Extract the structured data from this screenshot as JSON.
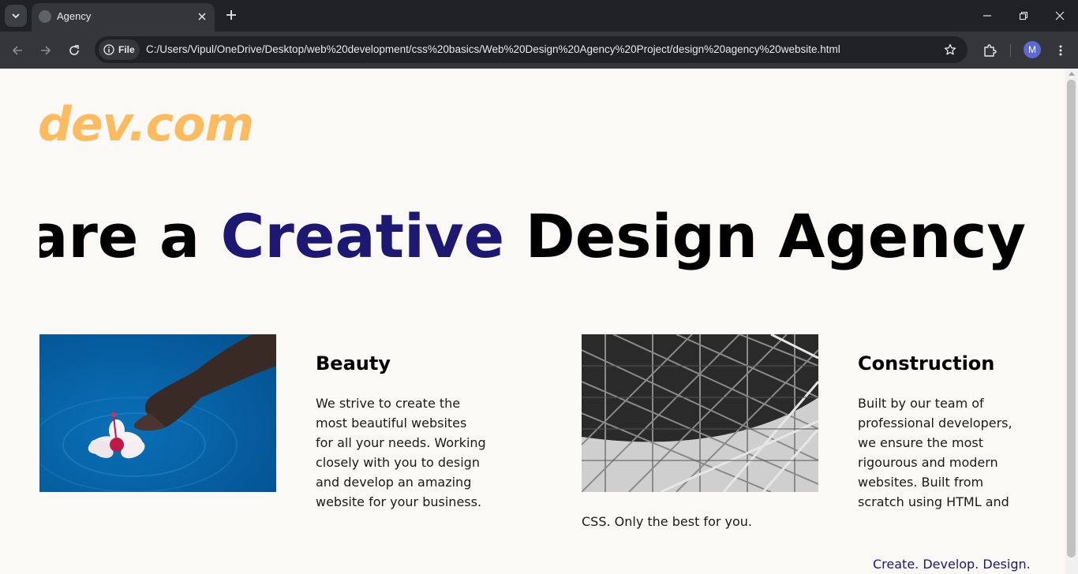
{
  "browser": {
    "tab": {
      "title": "Agency"
    },
    "address_bar": {
      "scheme_label": "File",
      "url": "C:/Users/Vipul/OneDrive/Desktop/web%20development/css%20basics/Web%20Design%20Agency%20Project/design%20agency%20website.html"
    },
    "profile_initial": "M"
  },
  "page": {
    "logo": "dev.com",
    "hero": {
      "part1": "We are a ",
      "accent": "Creative",
      "part2": " Design Agency"
    },
    "features": [
      {
        "title": "Beauty",
        "lines": [
          "We strive to create the",
          "most beautiful websites",
          "for all your needs. Working",
          "closely with you to design",
          "and develop an amazing",
          "website for your business."
        ],
        "image": "hibiscus-flower-in-water-photo"
      },
      {
        "title": "Construction",
        "lines": [
          "Built by our team of",
          "professional developers,",
          "we ensure the most",
          "rigourous and modern",
          "websites. Built from",
          "scratch using HTML and"
        ],
        "overflow_line": "CSS. Only the best for you.",
        "image": "steel-structure-photo"
      }
    ],
    "tagline": "Create. Develop. Design."
  },
  "colors": {
    "logo": "#fdbb60",
    "accent": "#1d1872",
    "background": "#fbf9f5",
    "chrome_dark": "#202124",
    "chrome_toolbar": "#35363a"
  }
}
